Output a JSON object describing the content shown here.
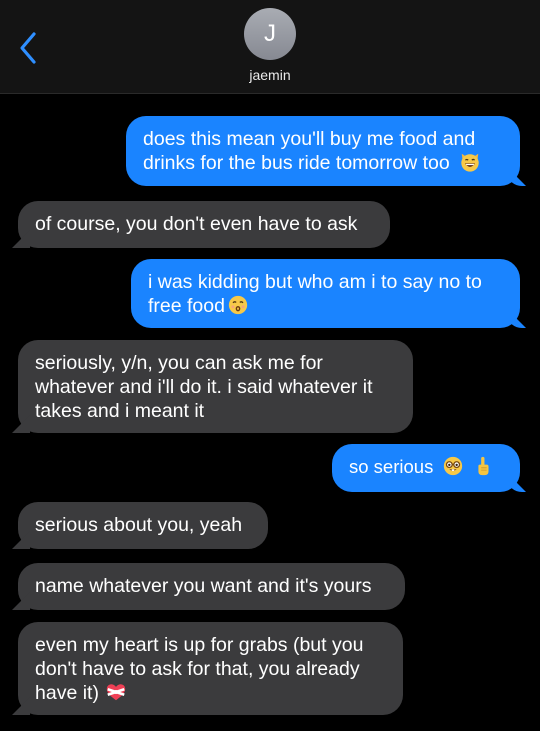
{
  "header": {
    "avatar_initial": "J",
    "contact_name": "jaemin",
    "back_icon": "chevron-left-icon"
  },
  "colors": {
    "sent_bubble": "#1a84ff",
    "received_bubble": "#3b3b3d",
    "background": "#000000",
    "back_chevron": "#2f8fff"
  },
  "messages": [
    {
      "direction": "sent",
      "lines": [
        "does this mean you'll buy me food and",
        "drinks for the bus ride tomorrow too"
      ],
      "emoji": "grinning-cat-icon"
    },
    {
      "direction": "received",
      "lines": [
        "of course, you don't even have to ask"
      ]
    },
    {
      "direction": "sent",
      "lines": [
        "i was kidding but who am i to say no to",
        "free food"
      ],
      "emoji": "kissing-face-icon"
    },
    {
      "direction": "received",
      "lines": [
        "seriously, y/n, you can ask me for",
        "whatever and i'll do it. i said whatever it",
        "takes and i meant it"
      ]
    },
    {
      "direction": "sent",
      "lines": [
        "so serious"
      ],
      "emoji": "nerd-face-icon",
      "emoji2": "index-pointing-up-icon"
    },
    {
      "direction": "received",
      "lines": [
        "serious about you, yeah"
      ]
    },
    {
      "direction": "received",
      "lines": [
        "name whatever you want and it's yours"
      ]
    },
    {
      "direction": "received",
      "lines": [
        "even my heart is up for grabs (but you",
        "don't have to ask for that, you already",
        "have it)"
      ],
      "emoji": "heart-with-ribbon-icon"
    }
  ]
}
